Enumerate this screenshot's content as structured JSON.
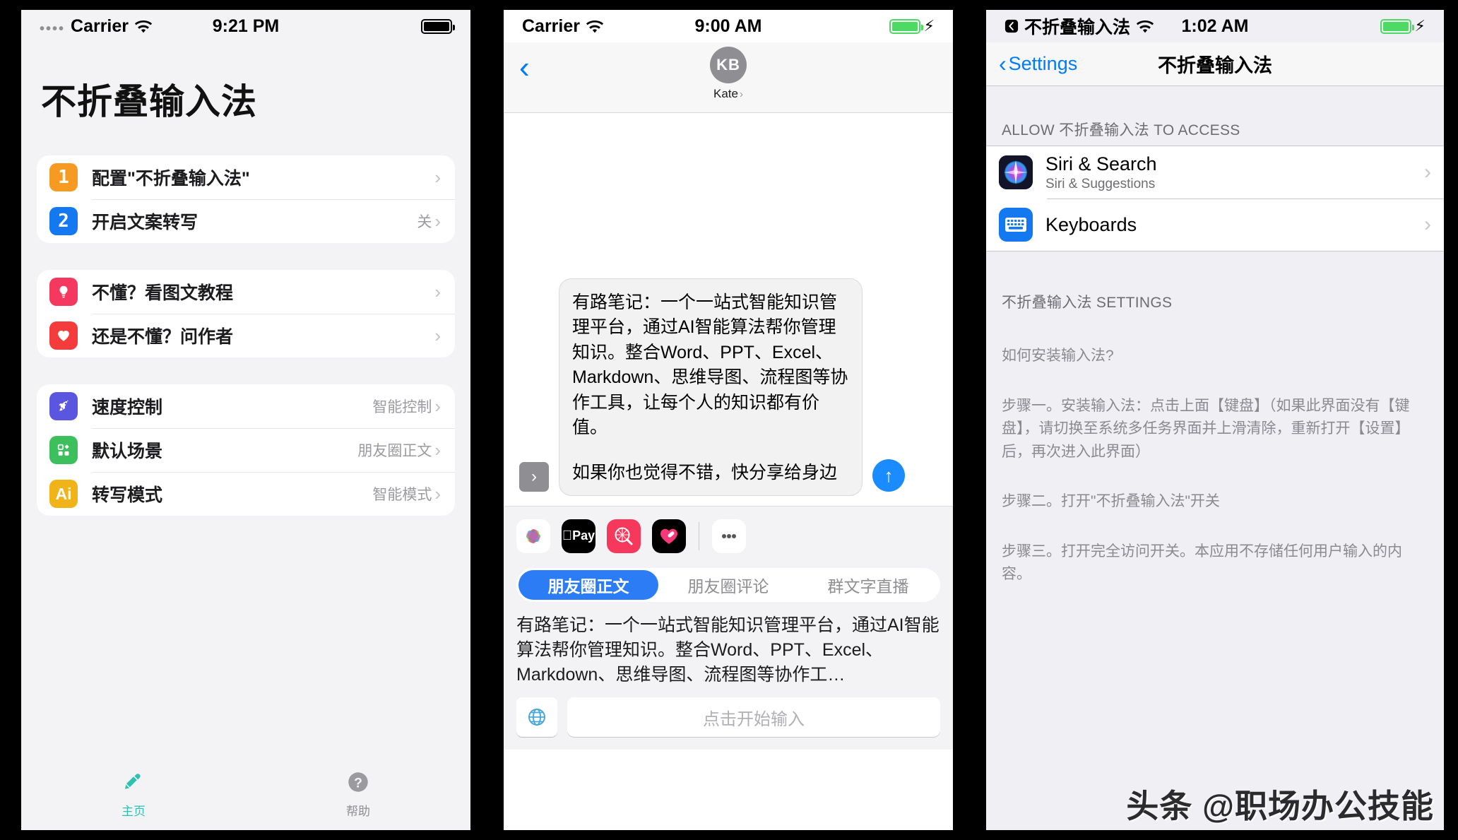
{
  "panel1": {
    "status": {
      "dots": "••••",
      "carrier": "Carrier",
      "time": "9:21 PM",
      "wifi_icon": "wifi-icon",
      "battery_icon": "battery-icon"
    },
    "title": "不折叠输入法",
    "group1": [
      {
        "badge": "1",
        "badge_color": "#f79a21",
        "label": "配置\"不折叠输入法\"",
        "value": "",
        "icon": "number-one-icon"
      },
      {
        "badge": "2",
        "badge_color": "#1478f0",
        "label": "开启文案转写",
        "value": "关",
        "icon": "number-two-icon"
      }
    ],
    "group2": [
      {
        "badge": "",
        "badge_color": "#f5395e",
        "label": "不懂？看图文教程",
        "value": "",
        "icon": "lightbulb-icon"
      },
      {
        "badge": "",
        "badge_color": "#f53c3c",
        "label": "还是不懂？问作者",
        "value": "",
        "icon": "heart-icon"
      }
    ],
    "group3": [
      {
        "badge": "",
        "badge_color": "#5a56e0",
        "label": "速度控制",
        "value": "智能控制",
        "icon": "rocket-icon"
      },
      {
        "badge": "",
        "badge_color": "#3dbf5e",
        "label": "默认场景",
        "value": "朋友圈正文",
        "icon": "grid-icon"
      },
      {
        "badge": "Ai",
        "badge_color": "#f0b419",
        "label": "转写模式",
        "value": "智能模式",
        "icon": "ai-icon"
      }
    ],
    "tabs": [
      {
        "label": "主页",
        "icon": "pen-icon",
        "active": true,
        "color": "#2cc2b0"
      },
      {
        "label": "帮助",
        "icon": "question-mark-icon",
        "active": false,
        "color": "#8e8e93"
      }
    ]
  },
  "panel2": {
    "status": {
      "carrier": "Carrier",
      "time": "9:00 AM",
      "wifi_icon": "wifi-icon",
      "battery_icon": "battery-charging-icon"
    },
    "nav": {
      "back_icon": "chevron-left-icon",
      "avatar_initials": "KB",
      "contact_name": "Kate",
      "contact_chevron": "›"
    },
    "bubble": {
      "paragraph1": "有路笔记：一个一站式智能知识管理平台，通过AI智能算法帮你管理知识。整合Word、PPT、Excel、Markdown、思维导图、流程图等协作工具，让每个人的知识都有价值。",
      "paragraph2": "如果你也觉得不错，快分享给身边",
      "expand_icon": "chevron-right-icon",
      "send_icon": "send-arrow-up-icon"
    },
    "app_strip": [
      {
        "name": "photos-icon",
        "bg": "#ffffff"
      },
      {
        "name": "apple-pay-icon",
        "bg": "#000000",
        "label": " Pay"
      },
      {
        "name": "store-search-icon",
        "bg": "#f5385c"
      },
      {
        "name": "health-heart-icon",
        "bg": "#000000"
      },
      {
        "name": "more-dots-icon",
        "bg": "#ffffff"
      }
    ],
    "segments": [
      {
        "label": "朋友圈正文",
        "active": true
      },
      {
        "label": "朋友圈评论",
        "active": false
      },
      {
        "label": "群文字直播",
        "active": false
      }
    ],
    "preview_text": "有路笔记：一个一站式智能知识管理平台，通过AI智能算法帮你管理知识。整合Word、PPT、Excel、Markdown、思维导图、流程图等协作工…",
    "keyboard": {
      "globe_icon": "globe-icon",
      "input_placeholder": "点击开始输入"
    }
  },
  "panel3": {
    "status": {
      "back_app": "不折叠输入法",
      "back_icon": "back-arrow-badge-icon",
      "time": "1:02 AM",
      "wifi_icon": "wifi-icon",
      "battery_icon": "battery-charging-icon"
    },
    "nav": {
      "back_label": "Settings",
      "back_icon": "chevron-left-icon",
      "title": "不折叠输入法"
    },
    "section_header": "ALLOW 不折叠输入法 TO ACCESS",
    "rows": [
      {
        "title": "Siri & Search",
        "subtitle": "Siri & Suggestions",
        "icon": "siri-icon"
      },
      {
        "title": "Keyboards",
        "subtitle": "",
        "icon": "keyboard-icon"
      }
    ],
    "settings_header": "不折叠输入法 SETTINGS",
    "notes": [
      "如何安装输入法?",
      "步骤一。安装输入法：点击上面【键盘】（如果此界面没有【键盘】，请切换至系统多任务界面并上滑清除，重新打开【设置】后，再次进入此界面）",
      "步骤二。打开\"不折叠输入法\"开关",
      "步骤三。打开完全访问开关。本应用不存储任何用户输入的内容。"
    ]
  },
  "watermark": "头条 @职场办公技能"
}
